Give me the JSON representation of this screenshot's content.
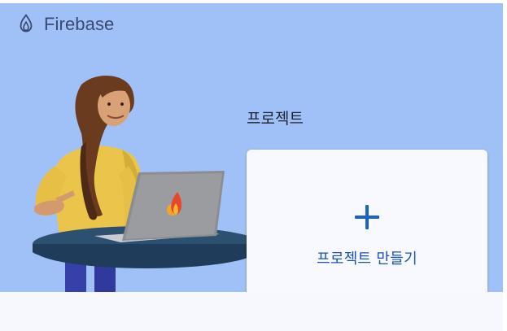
{
  "brand": {
    "name": "Firebase",
    "logo_icon": "firebase-flame-icon"
  },
  "projects": {
    "section_title": "프로젝트",
    "create_card": {
      "label": "프로젝트 만들기",
      "icon": "plus-icon",
      "accent_color": "#1a62c7"
    }
  },
  "hero": {
    "background_color": "#a0c1f8"
  }
}
